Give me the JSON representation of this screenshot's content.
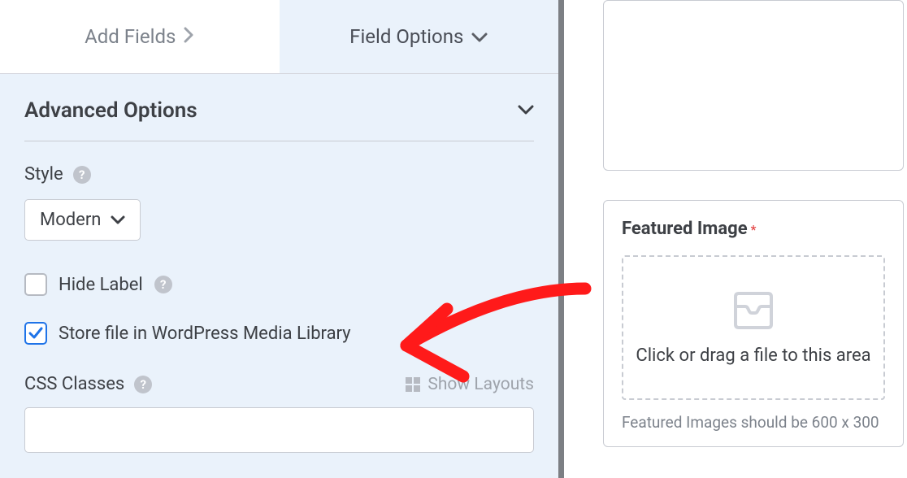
{
  "tabs": {
    "add_fields": "Add Fields",
    "field_options": "Field Options"
  },
  "section": {
    "title": "Advanced Options"
  },
  "style": {
    "label": "Style",
    "value": "Modern"
  },
  "hide_label": {
    "label": "Hide Label",
    "checked": false
  },
  "store_media": {
    "label": "Store file in WordPress Media Library",
    "checked": true
  },
  "css_classes": {
    "label": "CSS Classes",
    "show_layouts": "Show Layouts",
    "value": ""
  },
  "featured": {
    "title": "Featured Image",
    "required_mark": "*",
    "drop_text": "Click or drag a file to this area",
    "note": "Featured Images should be 600 x 300"
  }
}
